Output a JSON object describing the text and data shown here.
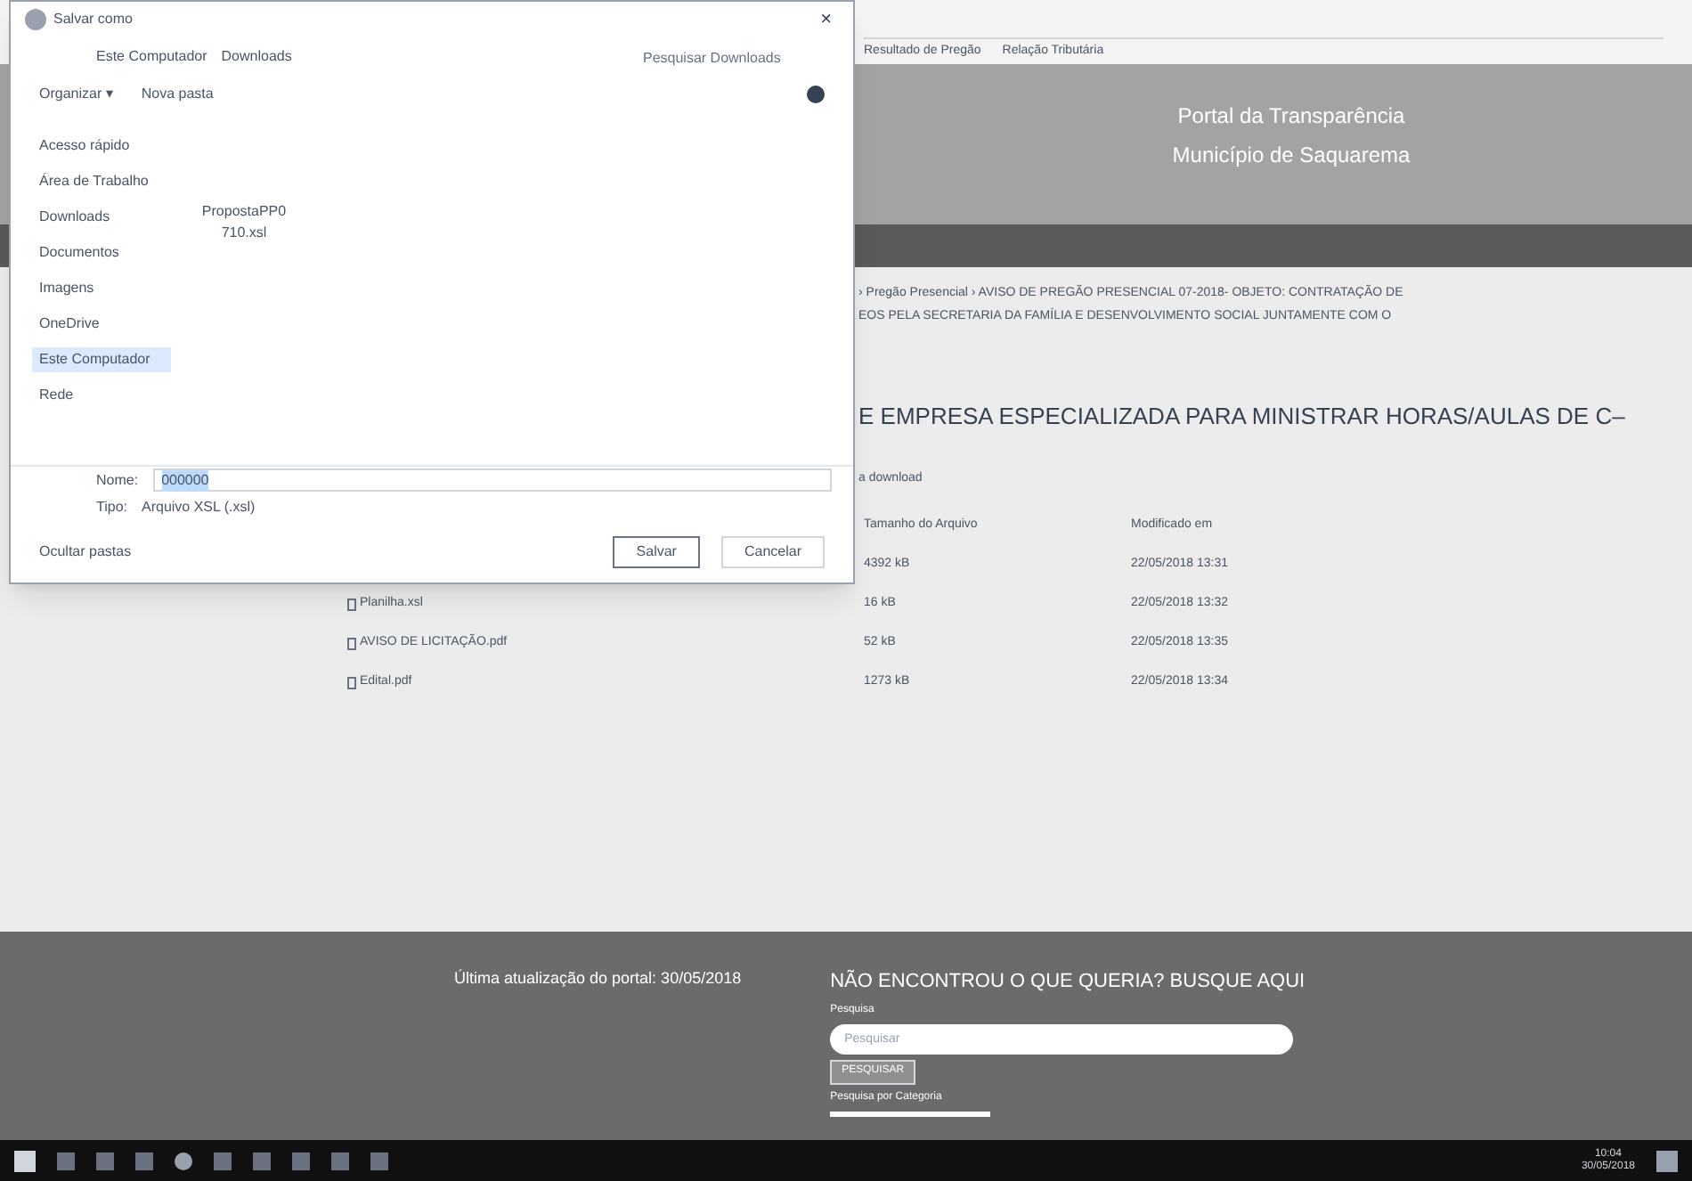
{
  "dialog": {
    "title": "Salvar como",
    "close": "×",
    "path": [
      "Este Computador",
      "Downloads"
    ],
    "search": {
      "placeholder": "Pesquisar Downloads"
    },
    "toolbar": [
      "Organizar ▾",
      "Nova pasta"
    ],
    "sidebar": [
      {
        "label": "Acesso rápido",
        "selected": false
      },
      {
        "label": "Área de Trabalho",
        "selected": false
      },
      {
        "label": "Downloads",
        "selected": false
      },
      {
        "label": "Documentos",
        "selected": false
      },
      {
        "label": "Imagens",
        "selected": false
      },
      {
        "label": "OneDrive",
        "selected": false
      },
      {
        "label": "Este Computador",
        "selected": true
      },
      {
        "label": "Rede",
        "selected": false
      }
    ],
    "files": [
      "PropostaPP0710.xsl"
    ],
    "name_label": "Nome:",
    "name_value": "000000",
    "type_label": "Tipo:",
    "type_value": "Arquivo XSL (.xsl)",
    "hide_folders": "Ocultar pastas",
    "buttons": [
      "Salvar",
      "Cancelar"
    ]
  },
  "browser": {
    "bookmarks": [
      "Resultado de Pregão",
      "Relação Tributária"
    ]
  },
  "header": {
    "title": "Portal da Transparência",
    "subtitle": "Município de Saquarema"
  },
  "breadcrumb": [
    "› Pregão Presencial › AVISO DE PREGÃO PRESENCIAL 07-2018- OBJETO: CONTRATAÇÃO DE",
    "EOS PELA SECRETARIA DA FAMÍLIA E DESENVOLVIMENTO SOCIAL JUNTAMENTE COM O"
  ],
  "page_title": "E EMPRESA ESPECIALIZADA PARA MINISTRAR HORAS/AULAS DE C–",
  "download_hint": "a download",
  "table": {
    "columns": [
      "Tamanho do Arquivo",
      "Modificado em"
    ],
    "rows": [
      {
        "name": "",
        "size": "4392 kB",
        "modified": "22/05/2018 13:31"
      },
      {
        "name": "Planilha.xsl",
        "size": "16 kB",
        "modified": "22/05/2018 13:32"
      },
      {
        "name": "AVISO DE LICITAÇÃO.pdf",
        "size": "52 kB",
        "modified": "22/05/2018 13:35"
      },
      {
        "name": "Edital.pdf",
        "size": "1273 kB",
        "modified": "22/05/2018 13:34"
      }
    ]
  },
  "footer": {
    "updated": "Última atualização do portal: 30/05/2018",
    "search_title": "NÃO ENCONTROU O QUE QUERIA? BUSQUE AQUI",
    "search_label": "Pesquisa",
    "search_placeholder": "Pesquisar",
    "search_button": "PESQUISAR",
    "category_label": "Pesquisa por Categoria"
  },
  "taskbar": {
    "time": "10:04",
    "date": "30/05/2018"
  }
}
